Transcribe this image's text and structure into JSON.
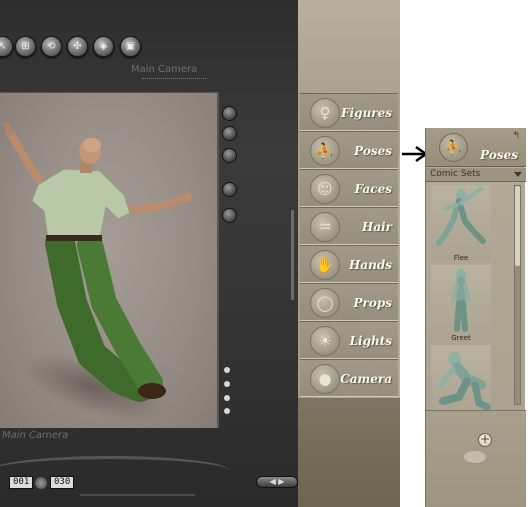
{
  "viewport": {
    "camera_label_top": "Main Camera",
    "camera_label_bottom": "Main Camera",
    "frame_current": "001",
    "frame_total": "030",
    "toolbar_icons": [
      "select-icon",
      "translate-icon",
      "rotate-icon",
      "twist-icon",
      "taper-icon",
      "scale-icon"
    ]
  },
  "library": {
    "categories": [
      {
        "label": "Figures",
        "icon": "figure-icon"
      },
      {
        "label": "Poses",
        "icon": "running-figure-icon"
      },
      {
        "label": "Faces",
        "icon": "face-icon"
      },
      {
        "label": "Hair",
        "icon": "hair-icon"
      },
      {
        "label": "Hands",
        "icon": "hand-icon"
      },
      {
        "label": "Props",
        "icon": "ring-icon"
      },
      {
        "label": "Lights",
        "icon": "bulb-icon"
      },
      {
        "label": "Camera",
        "icon": "camera-icon"
      }
    ]
  },
  "poses_panel": {
    "title": "Poses",
    "set_selected": "Comic Sets",
    "thumbnails": [
      {
        "label": "Flee"
      },
      {
        "label": "Greet"
      },
      {
        "label": ""
      }
    ]
  },
  "colors": {
    "library_bg": "#b4ac9b",
    "label_text": "#fbf9f2",
    "figure_shirt": "#b9c9a8",
    "figure_pants": "#3e6b2c",
    "canvas_bg": "#968e86"
  }
}
